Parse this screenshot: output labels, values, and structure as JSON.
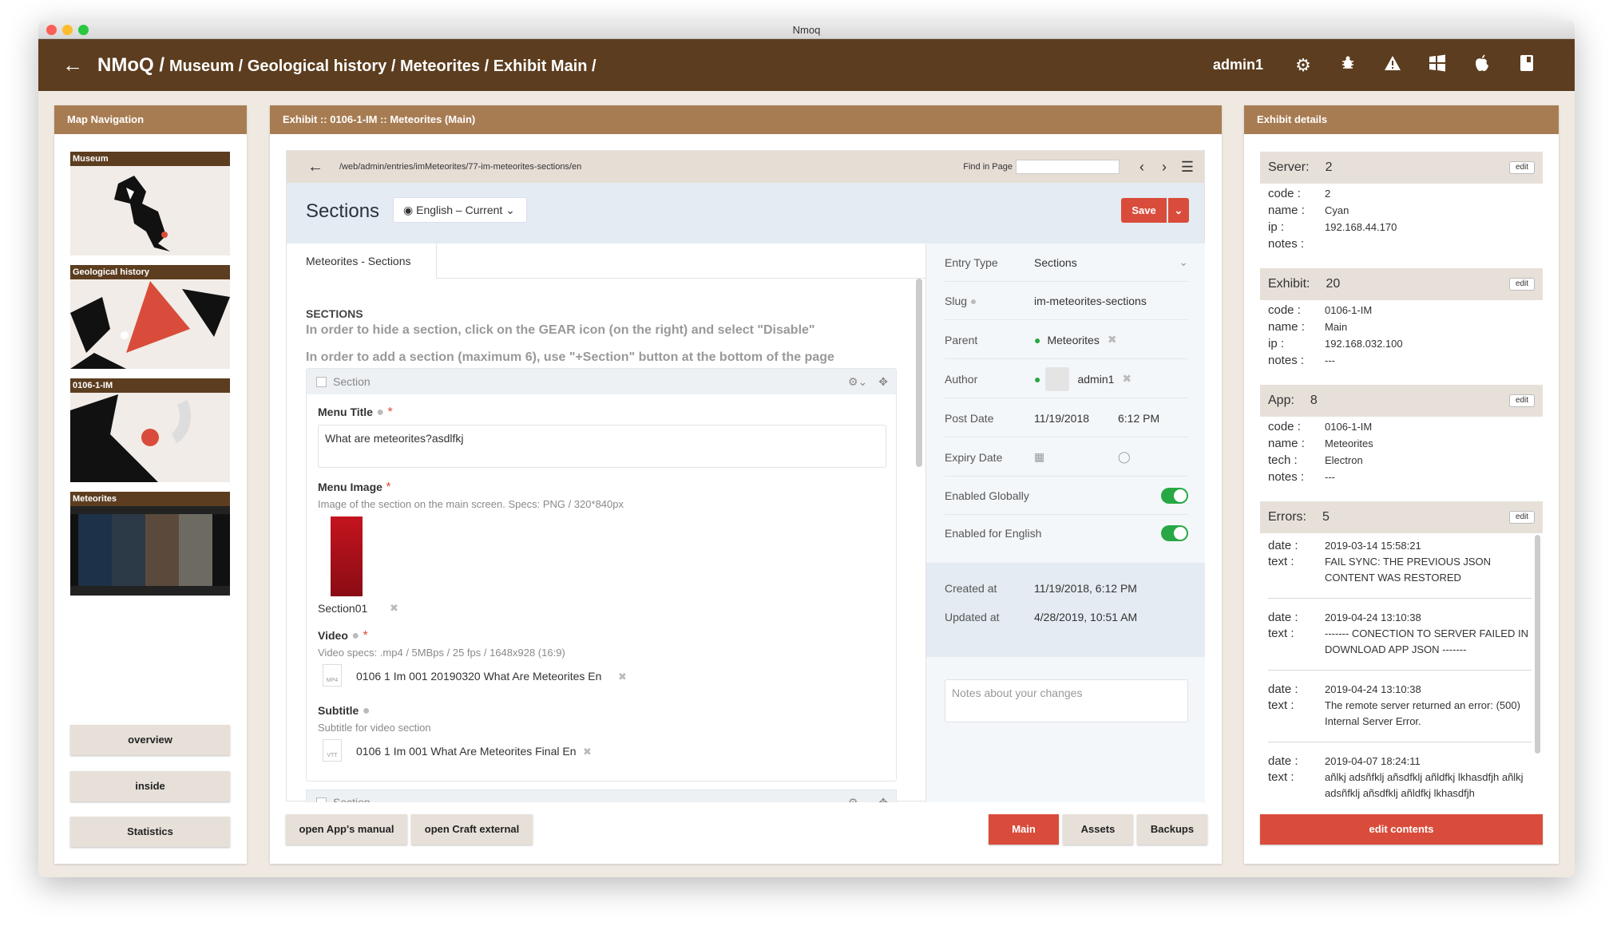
{
  "window": {
    "title": "Nmoq"
  },
  "appbar": {
    "brand": "NMoQ /",
    "crumbs": [
      "Museum /",
      "Geological history /",
      "Meteorites /",
      "Exhibit Main /"
    ],
    "user": "admin1"
  },
  "mapnav": {
    "title": "Map Navigation",
    "thumbs": [
      "Museum",
      "Geological history",
      "0106-1-IM",
      "Meteorites"
    ],
    "buttons": [
      "overview",
      "inside",
      "Statistics"
    ]
  },
  "exhibit": {
    "title": "Exhibit :: 0106-1-IM :: Meteorites (Main)",
    "url": "/web/admin/entries/imMeteorites/77-im-meteorites-sections/en",
    "find_label": "Find in Page",
    "section_title": "Sections",
    "language": "English – Current",
    "save": "Save",
    "tab": "Meteorites - Sections",
    "form": {
      "heading": "SECTIONS",
      "instr1": "In order to hide a section, click on the GEAR icon (on the right) and select \"Disable\"",
      "instr2": "In order to add a section (maximum 6), use \"+Section\" button at the bottom of the page",
      "block_label": "Section",
      "menu_title_label": "Menu Title",
      "menu_title_value": "What are meteorites?asdlfkj",
      "menu_image_label": "Menu Image",
      "menu_image_hint": "Image of the section on the main screen. Specs: PNG / 320*840px",
      "image_name": "Section01",
      "video_label": "Video",
      "video_hint": "Video specs: .mp4 / 5MBps / 25 fps / 1648x928 (16:9)",
      "video_tag": "MP4",
      "video_file": "0106 1 Im 001 20190320 What Are Meteorites En",
      "subtitle_label": "Subtitle",
      "subtitle_hint": "Subtitle for video section",
      "subtitle_tag": "VTT",
      "subtitle_file": "0106 1 Im 001 What Are Meteorites Final En",
      "block2_label": "Section"
    },
    "side": {
      "entry_type_k": "Entry Type",
      "entry_type_v": "Sections",
      "slug_k": "Slug",
      "slug_v": "im-meteorites-sections",
      "parent_k": "Parent",
      "parent_v": "Meteorites",
      "author_k": "Author",
      "author_v": "admin1",
      "post_k": "Post Date",
      "post_date": "11/19/2018",
      "post_time": "6:12 PM",
      "expiry_k": "Expiry Date",
      "global_k": "Enabled Globally",
      "english_k": "Enabled for English",
      "created_k": "Created at",
      "created_v": "11/19/2018, 6:12 PM",
      "updated_k": "Updated at",
      "updated_v": "4/28/2019, 10:51 AM",
      "notes_placeholder": "Notes about your changes"
    },
    "footer": {
      "manual": "open App's manual",
      "craft": "open Craft external",
      "main": "Main",
      "assets": "Assets",
      "backups": "Backups"
    }
  },
  "details": {
    "title": "Exhibit details",
    "edit": "edit",
    "server": {
      "label": "Server:",
      "value": "2",
      "code_k": "code :",
      "code": "2",
      "name_k": "name :",
      "name": "Cyan",
      "ip_k": "ip :",
      "ip": "192.168.44.170",
      "notes_k": "notes :",
      "notes": ""
    },
    "exhibit": {
      "label": "Exhibit:",
      "value": "20",
      "code_k": "code :",
      "code": "0106-1-IM",
      "name_k": "name :",
      "name": "Main",
      "ip_k": "ip :",
      "ip": "192.168.032.100",
      "notes_k": "notes :",
      "notes": "---"
    },
    "app": {
      "label": "App:",
      "value": "8",
      "code_k": "code :",
      "code": "0106-1-IM",
      "name_k": "name :",
      "name": "Meteorites",
      "tech_k": "tech :",
      "tech": "Electron",
      "notes_k": "notes :",
      "notes": "---"
    },
    "errors": {
      "label": "Errors:",
      "value": "5",
      "date_k": "date :",
      "text_k": "text :",
      "items": [
        {
          "date": "2019-03-14 15:58:21",
          "text": "FAIL SYNC: THE PREVIOUS JSON CONTENT WAS RESTORED"
        },
        {
          "date": "2019-04-24 13:10:38",
          "text": "------- CONECTION TO SERVER FAILED IN DOWNLOAD APP JSON -------"
        },
        {
          "date": "2019-04-24 13:10:38",
          "text": "The remote server returned an error: (500) Internal Server Error."
        },
        {
          "date": "2019-04-07 18:24:11",
          "text": "añlkj adsñfklj añsdfklj añldfkj lkhasdfjh añlkj adsñfklj añsdfklj añldfkj lkhasdfjh"
        }
      ]
    },
    "edit_contents": "edit contents"
  }
}
